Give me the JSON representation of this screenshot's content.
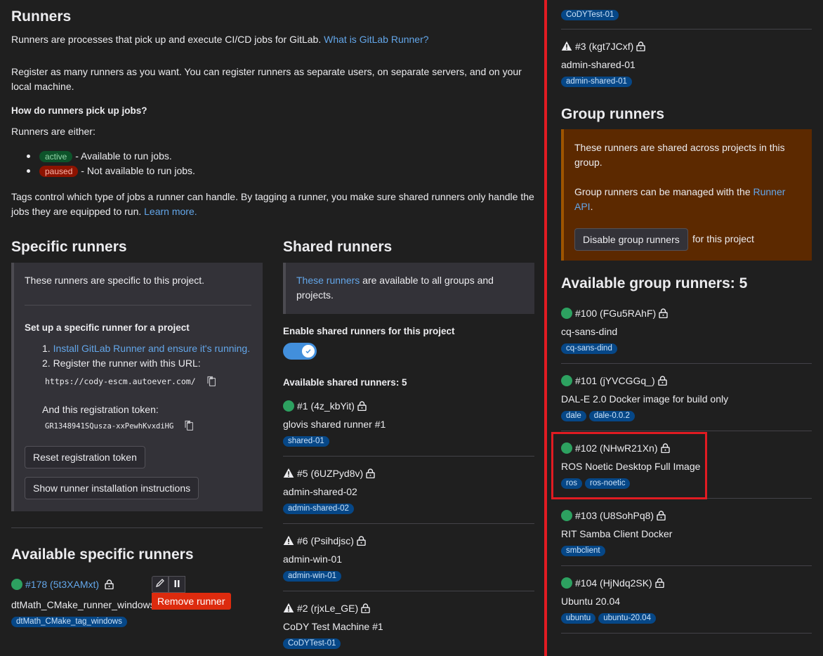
{
  "intro": {
    "title": "Runners",
    "description": "Runners are processes that pick up and execute CI/CD jobs for GitLab.",
    "description_link": "What is GitLab Runner?",
    "register_text": "Register as many runners as you want. You can register runners as separate users, on separate servers, and on your local machine.",
    "pickup_heading": "How do runners pick up jobs?",
    "either_text": "Runners are either:",
    "states": [
      {
        "badge": "active",
        "text": "- Available to run jobs."
      },
      {
        "badge": "paused",
        "text": "- Not available to run jobs."
      }
    ],
    "tags_text": "Tags control which type of jobs a runner can handle. By tagging a runner, you make sure shared runners only handle the jobs they are equipped to run.",
    "tags_link": "Learn more."
  },
  "specific": {
    "title": "Specific runners",
    "panel_text": "These runners are specific to this project.",
    "setup_heading": "Set up a specific runner for a project",
    "step1_num": "1.",
    "step1_link": "Install GitLab Runner and ensure it's running.",
    "step2": "2. Register the runner with this URL:",
    "url": "https://cody-escm.autoever.com/",
    "token_label": "And this registration token:",
    "token": "GR1348941SQusza-xxPewhKvxdiHG",
    "reset_button": "Reset registration token",
    "show_button": "Show runner installation instructions",
    "available_title": "Available specific runners",
    "runner": {
      "id": "#178 (5t3XAMxt)",
      "name": "dtMath_CMake_runner_windows",
      "tag": "dtMath_CMake_tag_windows",
      "remove_button": "Remove runner"
    }
  },
  "shared": {
    "title": "Shared runners",
    "panel_link": "These runners",
    "panel_text": "are available to all groups and projects.",
    "enable_label": "Enable shared runners for this project",
    "available_label": "Available shared runners: 5",
    "runners": [
      {
        "status": "online",
        "id": "#1 (4z_kbYit)",
        "name": "glovis shared runner #1",
        "tags": [
          "shared-01"
        ]
      },
      {
        "status": "warning",
        "id": "#5 (6UZPyd8v)",
        "name": "admin-shared-02",
        "tags": [
          "admin-shared-02"
        ]
      },
      {
        "status": "warning",
        "id": "#6 (Psihdjsc)",
        "name": "admin-win-01",
        "tags": [
          "admin-win-01"
        ]
      },
      {
        "status": "warning",
        "id": "#2 (rjxLe_GE)",
        "name": "CoDY Test Machine #1",
        "tags": [
          "CoDYTest-01"
        ]
      }
    ]
  },
  "right": {
    "top_tag": "CoDYTest-01",
    "shared_runner3": {
      "status": "warning",
      "id": "#3 (kgt7JCxf)",
      "name": "admin-shared-01",
      "tags": [
        "admin-shared-01"
      ]
    },
    "group_title": "Group runners",
    "group_panel_text1": "These runners are shared across projects in this group.",
    "group_panel_text2": "Group runners can be managed with the",
    "group_panel_link": "Runner API",
    "disable_button": "Disable group runners",
    "disable_suffix": "for this project",
    "available_title": "Available group runners: 5",
    "group_runners": [
      {
        "status": "online",
        "id": "#100 (FGu5RAhF)",
        "name": "cq-sans-dind",
        "tags": [
          "cq-sans-dind"
        ]
      },
      {
        "status": "online",
        "id": "#101 (jYVCGGq_)",
        "name": "DAL-E 2.0 Docker image for build only",
        "tags": [
          "dale",
          "dale-0.0.2"
        ]
      },
      {
        "status": "online",
        "id": "#102 (NHwR21Xn)",
        "name": "ROS Noetic Desktop Full Image",
        "tags": [
          "ros",
          "ros-noetic"
        ]
      },
      {
        "status": "online",
        "id": "#103 (U8SohPq8)",
        "name": "RIT Samba Client Docker",
        "tags": [
          "smbclient"
        ]
      },
      {
        "status": "online",
        "id": "#104 (HjNdq2SK)",
        "name": "Ubuntu 20.04",
        "tags": [
          "ubuntu",
          "ubuntu-20.04"
        ]
      }
    ]
  },
  "colors": {
    "background": "#1f1f1f",
    "link": "#63a6e9",
    "online": "#2da160",
    "tag_bg": "#064787",
    "highlight": "#e11b22",
    "group_panel": "#5c2900"
  }
}
